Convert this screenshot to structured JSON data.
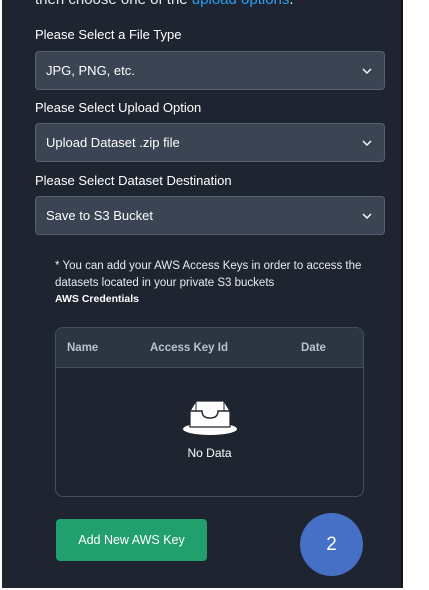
{
  "header": {
    "cut_text_prefix": "then choose one of the ",
    "cut_text_link": "upload options",
    "cut_text_suffix": "."
  },
  "file_type": {
    "label": "Please Select a File Type",
    "value": "JPG, PNG, etc."
  },
  "upload_option": {
    "label": "Please Select Upload Option",
    "value": "Upload Dataset .zip file"
  },
  "destination": {
    "label": "Please Select Dataset Destination",
    "value": "Save to S3 Bucket"
  },
  "aws": {
    "note": "* You can add your AWS Access Keys in order to access the datasets located in your private S3 buckets",
    "title": "AWS Credentials",
    "table": {
      "columns": [
        "Name",
        "Access Key Id",
        "Date"
      ],
      "empty_text": "No Data"
    },
    "add_button": "Add New AWS Key"
  },
  "step_badge": "2",
  "colors": {
    "panel_bg": "#1e2530",
    "select_bg": "#3a4453",
    "accent_green": "#21a06d",
    "badge_blue": "#4670c5",
    "link_blue": "#2a9df4"
  }
}
